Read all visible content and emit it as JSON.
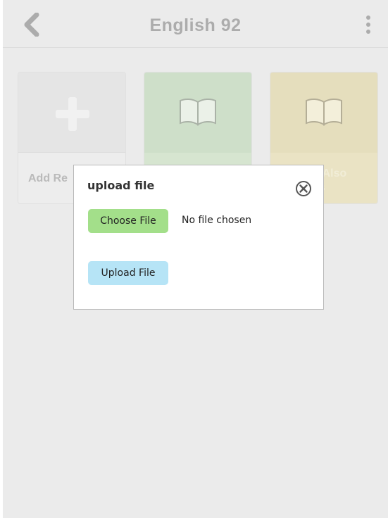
{
  "header": {
    "title": "English 92",
    "back_icon": "chevron-left-icon",
    "menu_icon": "more-vertical-icon"
  },
  "tiles": [
    {
      "label": "Add Re",
      "icon": "plus-icon",
      "color": "#dcdcdc"
    },
    {
      "label": "",
      "icon": "book-icon",
      "color": "#bcd3b4"
    },
    {
      "label": "n Also\nes",
      "icon": "book-icon",
      "color": "#dbd1a4"
    }
  ],
  "dialog": {
    "title": "upload file",
    "close_icon": "close-circle-icon",
    "choose_label": "Choose File",
    "file_status": "No file chosen",
    "upload_label": "Upload File",
    "choose_color": "#a3df8a",
    "upload_color": "#b6e4f6"
  }
}
